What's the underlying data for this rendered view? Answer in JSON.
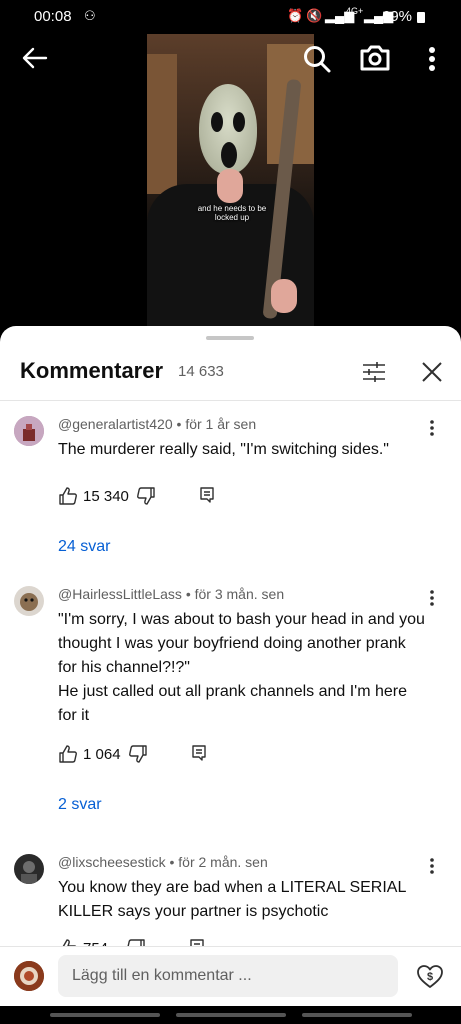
{
  "status_bar": {
    "time": "00:08",
    "network": "4G+",
    "battery": "69%"
  },
  "video": {
    "caption": "and he needs to be locked up"
  },
  "top_actions": {
    "back": "arrow-back-icon",
    "search": "search-icon",
    "camera": "camera-icon",
    "more": "more-vert-icon"
  },
  "comments_panel": {
    "title": "Kommentarer",
    "count": "14 633",
    "comments": [
      {
        "author": "@generalartist420",
        "time": "för 1 år sen",
        "text": "The murderer really said, \"I'm switching sides.\"",
        "likes": "15 340",
        "replies": "24 svar"
      },
      {
        "author": "@HairlessLittleLass",
        "time": "för 3 mån. sen",
        "text": "\"I'm sorry, I was about to bash your head in and you thought I was your boyfriend doing another prank for his channel?!?\"\nHe just called out all prank channels and I'm here for it",
        "likes": "1 064",
        "replies": "2 svar"
      },
      {
        "author": "@lixscheesestick",
        "time": "för 2 mån. sen",
        "text": "You know they are bad when a LITERAL SERIAL KILLER says your partner is psychotic",
        "likes": "754"
      }
    ],
    "input_placeholder": "Lägg till en kommentar ..."
  },
  "colors": {
    "link": "#065fd4",
    "secondary_text": "#606060",
    "background": "#ffffff"
  }
}
